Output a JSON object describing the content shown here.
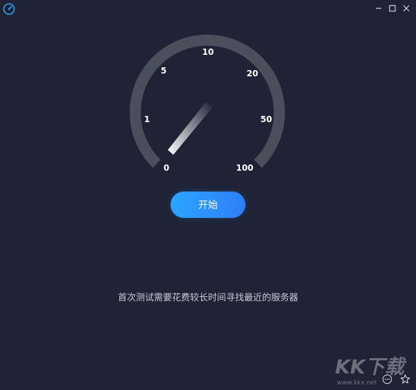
{
  "app": {
    "icon": "speedometer-icon",
    "accent": "#2aa6ff"
  },
  "window_controls": [
    {
      "name": "minimize-icon"
    },
    {
      "name": "maximize-icon"
    },
    {
      "name": "close-icon"
    }
  ],
  "gauge": {
    "tick_labels": [
      "0",
      "1",
      "5",
      "10",
      "20",
      "50",
      "100"
    ],
    "track_color": "#4b4f5c",
    "needle_value": "0"
  },
  "start_button": {
    "label": "开始",
    "color_start": "#2aa6ff",
    "color_end": "#2f7ef7"
  },
  "hint": {
    "text": "首次测试需要花费较长时间寻找最近的服务器"
  },
  "watermark": {
    "logo_text": "KK下载",
    "url": "www.kkx.net"
  },
  "bottom_icons": [
    "more-icon",
    "star-icon"
  ]
}
